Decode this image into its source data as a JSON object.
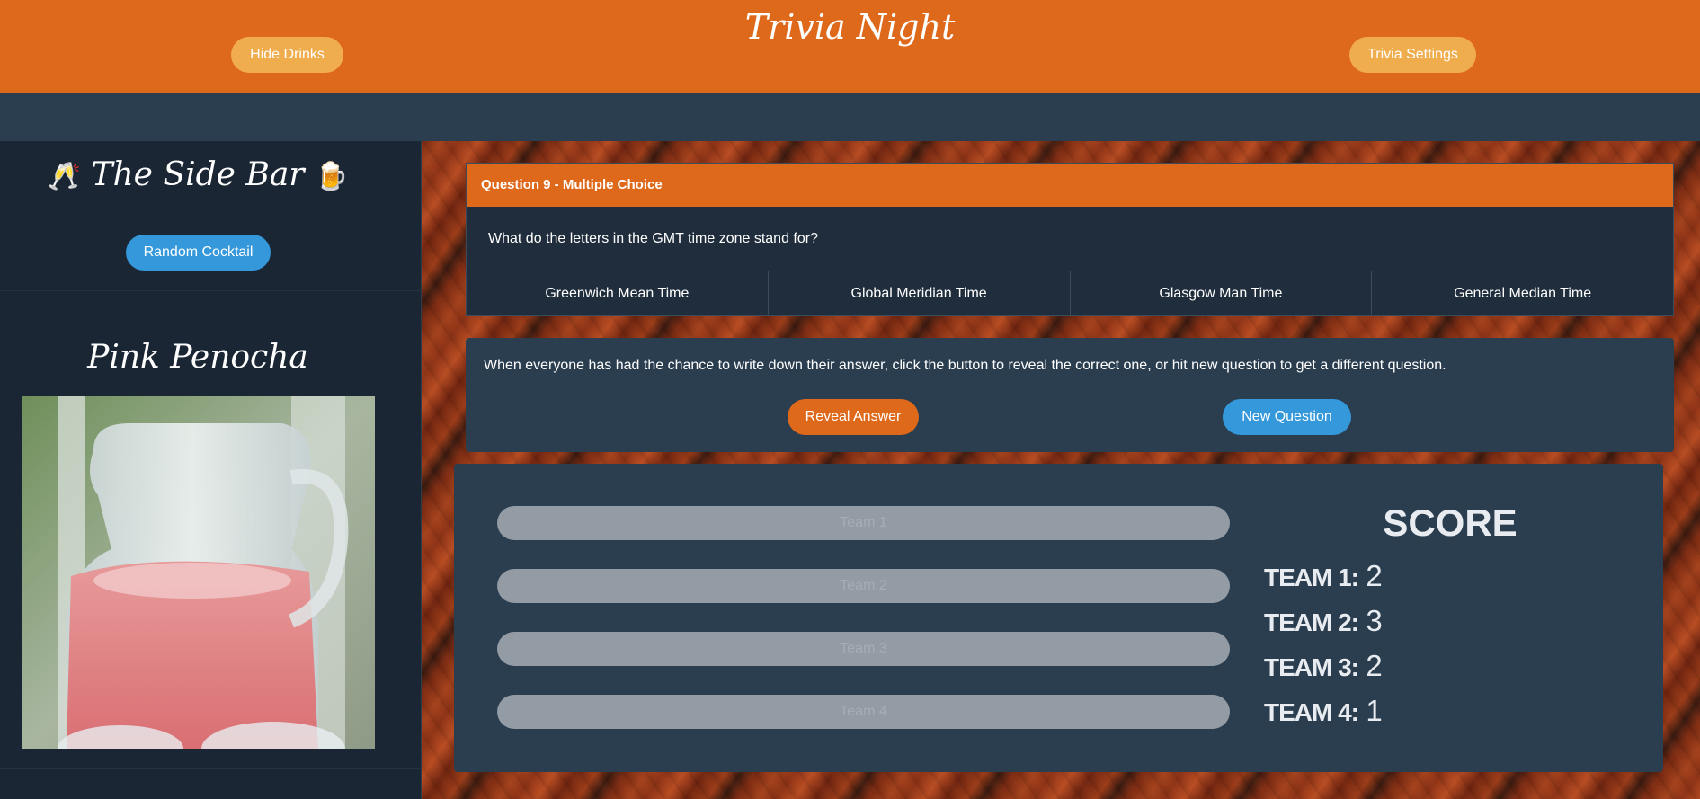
{
  "header": {
    "title": "Trivia Night",
    "hide_drinks_label": "Hide Drinks",
    "settings_label": "Trivia Settings"
  },
  "sidebar": {
    "title": "The Side Bar",
    "emoji_left": "🥂",
    "emoji_right": "🍺",
    "random_label": "Random Cocktail",
    "cocktail_name": "Pink Penocha"
  },
  "question": {
    "header": "Question 9 - Multiple Choice",
    "text": "What do the letters in the GMT time zone stand for?",
    "options": [
      "Greenwich Mean Time",
      "Global Meridian Time",
      "Glasgow Man Time",
      "General Median Time"
    ]
  },
  "instructions": {
    "text": "When everyone has had the chance to write down their answer, click the button to reveal the correct one, or hit new question to get a different question.",
    "reveal_label": "Reveal Answer",
    "new_label": "New Question"
  },
  "teams": {
    "placeholders": [
      "Team 1",
      "Team 2",
      "Team 3",
      "Team 4"
    ]
  },
  "score": {
    "title": "SCORE",
    "rows": [
      {
        "label": "TEAM 1:",
        "value": "2"
      },
      {
        "label": "TEAM 2:",
        "value": "3"
      },
      {
        "label": "TEAM 3:",
        "value": "2"
      },
      {
        "label": "TEAM 4:",
        "value": "1"
      }
    ]
  },
  "colors": {
    "brand_orange": "#df691a",
    "accent_blue": "#3498db",
    "warning_yellow": "#f0ad4e",
    "panel": "#2b3e50"
  }
}
